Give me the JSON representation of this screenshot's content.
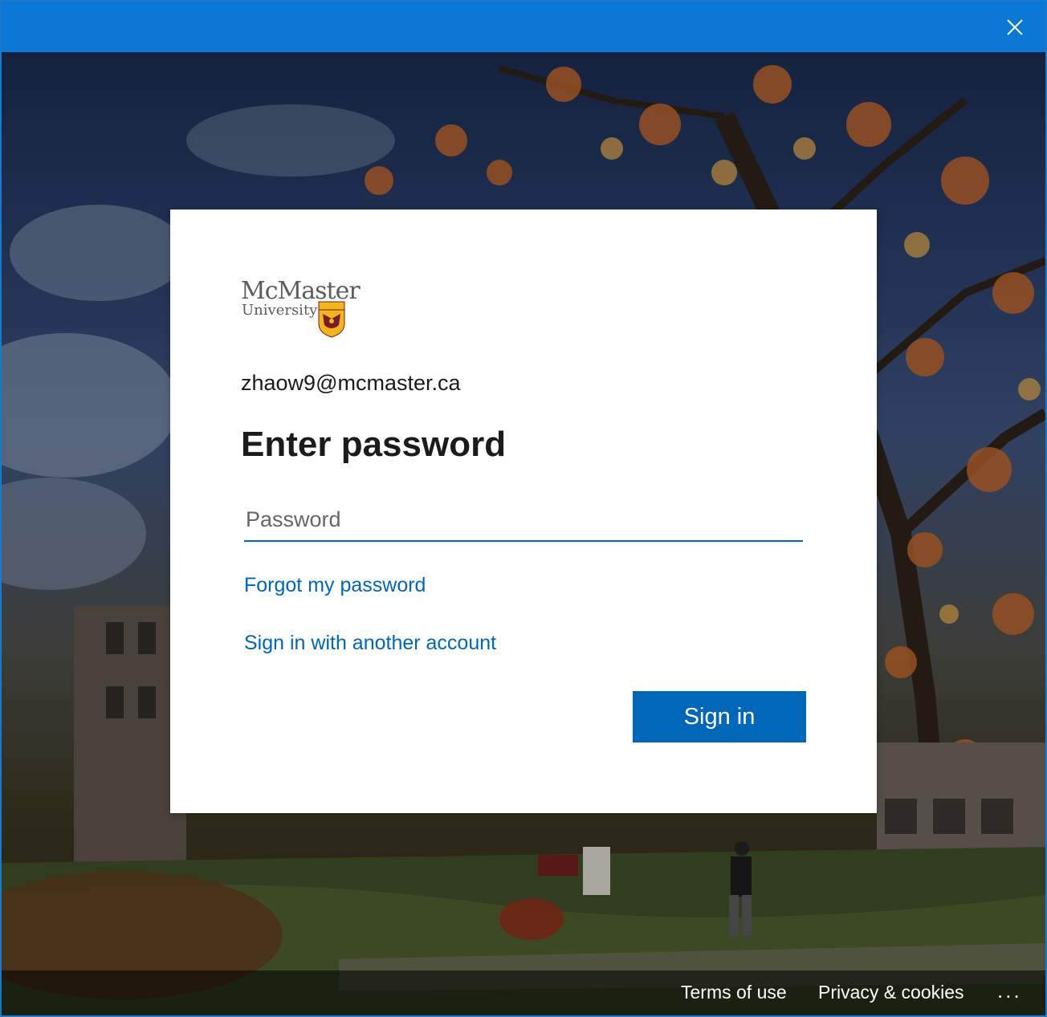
{
  "window": {
    "close_icon": "close-icon",
    "titlebar_color": "#0a78d4"
  },
  "logo": {
    "name": "McMaster",
    "sub": "University",
    "crest_icon": "crest-icon"
  },
  "account": {
    "email": "zhaow9@mcmaster.ca"
  },
  "form": {
    "title": "Enter password",
    "password_placeholder": "Password",
    "password_value": "",
    "forgot_label": "Forgot my password",
    "other_account_label": "Sign in with another account",
    "signin_label": "Sign in",
    "accent_color": "#0067b8"
  },
  "footer": {
    "terms_label": "Terms of use",
    "privacy_label": "Privacy & cookies",
    "more_label": "..."
  }
}
